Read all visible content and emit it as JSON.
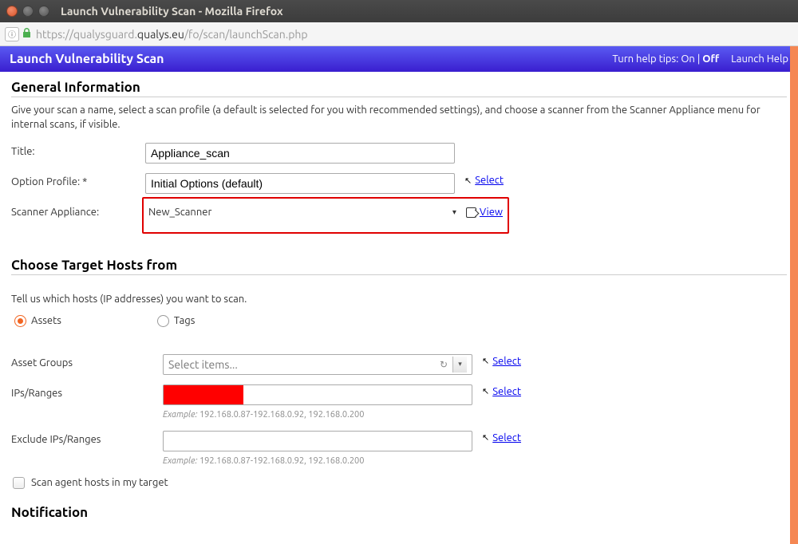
{
  "window": {
    "title": "Launch Vulnerability Scan - Mozilla Firefox"
  },
  "url": {
    "prefix": "https://qualysguard.",
    "domain": "qualys.eu",
    "path": "/fo/scan/launchScan.php"
  },
  "header": {
    "title": "Launch Vulnerability Scan",
    "tips_label": "Turn help tips:",
    "tips_on": "On",
    "tips_sep": " | ",
    "tips_off": "Off",
    "help": "Launch Help"
  },
  "general": {
    "heading": "General Information",
    "desc": "Give your scan a name, select a scan profile (a default is selected for you with recommended settings), and choose a scanner from the Scanner Appliance menu for internal scans, if visible.",
    "title_label": "Title:",
    "title_value": "Appliance_scan",
    "profile_label": "Option Profile: *",
    "profile_value": "Initial Options (default)",
    "select_link": "Select",
    "scanner_label": "Scanner Appliance:",
    "scanner_value": "New_Scanner",
    "view_link": "View"
  },
  "hosts": {
    "heading": "Choose Target Hosts from",
    "desc": "Tell us which hosts (IP addresses) you want to scan.",
    "radio_assets": "Assets",
    "radio_tags": "Tags",
    "asset_groups_label": "Asset Groups",
    "asset_groups_placeholder": "Select items...",
    "ips_label": "IPs/Ranges",
    "exclude_label": "Exclude IPs/Ranges",
    "example_prefix": "Example: ",
    "example_text": "192.168.0.87-192.168.0.92, 192.168.0.200",
    "select_link": "Select",
    "scan_agent_label": "Scan agent hosts in my target"
  },
  "notification": {
    "heading": "Notification"
  }
}
